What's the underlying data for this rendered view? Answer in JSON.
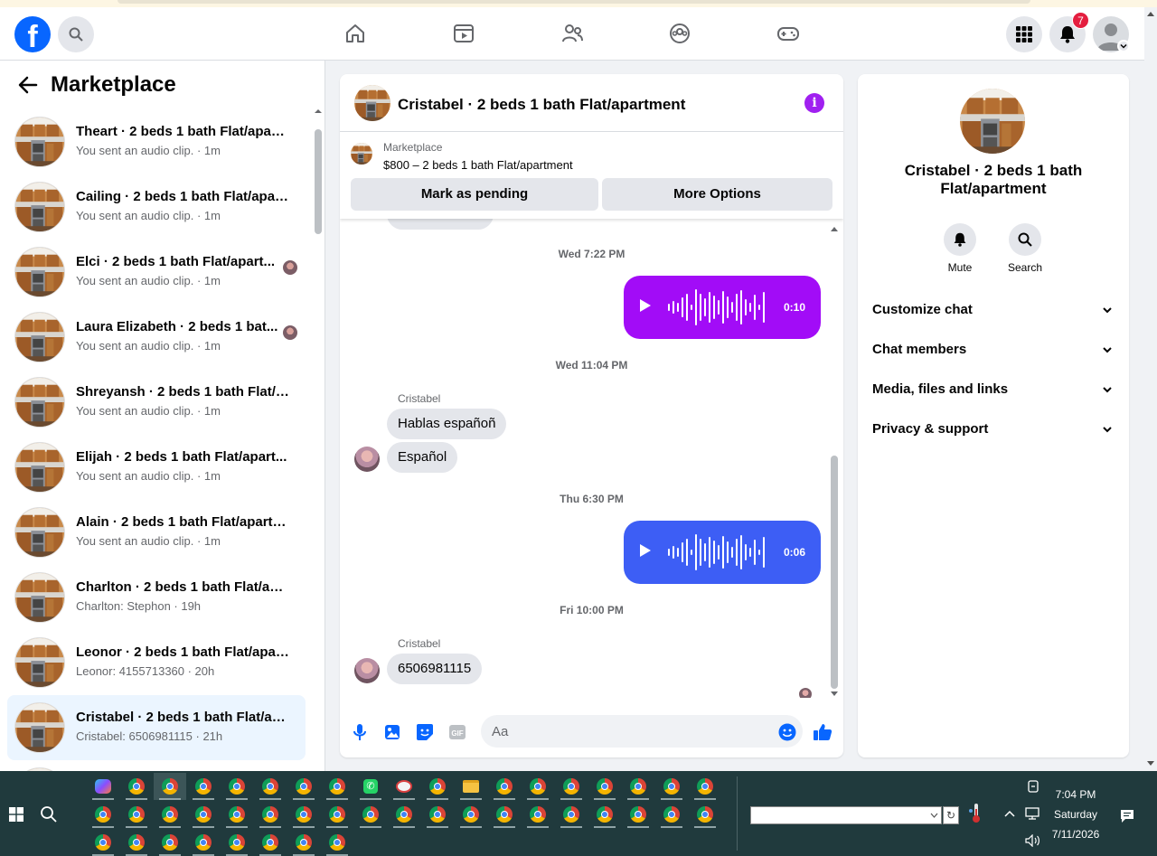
{
  "topnav": {
    "logo": "f",
    "notification_count": "7"
  },
  "sidebar": {
    "title": "Marketplace",
    "items": [
      {
        "name": "Theart · 2 beds 1 bath Flat/apart...",
        "sub": "You sent an audio clip. · 1m",
        "avatar": false
      },
      {
        "name": "Cailing · 2 beds 1 bath Flat/apart...",
        "sub": "You sent an audio clip. · 1m",
        "avatar": false
      },
      {
        "name": "Elci · 2 beds 1 bath Flat/apart...",
        "sub": "You sent an audio clip. · 1m",
        "avatar": true
      },
      {
        "name": "Laura Elizabeth · 2 beds 1 bat...",
        "sub": "You sent an audio clip. · 1m",
        "avatar": true
      },
      {
        "name": "Shreyansh · 2 beds 1 bath Flat/a...",
        "sub": "You sent an audio clip. · 1m",
        "avatar": false
      },
      {
        "name": "Elijah · 2 beds 1 bath Flat/apart...",
        "sub": "You sent an audio clip. · 1m",
        "avatar": false
      },
      {
        "name": "Alain · 2 beds 1 bath Flat/apartm...",
        "sub": "You sent an audio clip. · 1m",
        "avatar": false
      },
      {
        "name": "Charlton · 2 beds 1 bath Flat/apa...",
        "sub": "Charlton: Stephon · 19h",
        "avatar": false
      },
      {
        "name": "Leonor · 2 beds 1 bath Flat/apart...",
        "sub": "Leonor: 4155713360 · 20h",
        "avatar": false
      },
      {
        "name": "Cristabel · 2 beds 1 bath Flat/ap...",
        "sub": "Cristabel: 6506981115 · 21h",
        "avatar": false,
        "active": true
      }
    ]
  },
  "chat": {
    "title": "Cristabel · 2 beds 1 bath Flat/apartment",
    "marketplace_label": "Marketplace",
    "listing": "$800 – 2 beds 1 bath Flat/apartment",
    "btn_pending": "Mark as pending",
    "btn_more": "More Options",
    "messages": {
      "ts1": "Wed 7:22 PM",
      "audio1_duration": "0:10",
      "audio1_color": "#a20cf7",
      "ts2": "Wed 11:04 PM",
      "sender1": "Cristabel",
      "msg1": "Hablas españoñ",
      "msg2": "Español",
      "ts3": "Thu 6:30 PM",
      "audio2_duration": "0:06",
      "audio2_color": "#3d5ef5",
      "ts4": "Fri 10:00 PM",
      "sender2": "Cristabel",
      "msg3": "6506981115"
    },
    "composer_placeholder": "Aa"
  },
  "right_panel": {
    "title": "Cristabel · 2 beds 1 bath Flat/apartment",
    "mute": "Mute",
    "search": "Search",
    "rows": [
      "Customize chat",
      "Chat members",
      "Media, files and links",
      "Privacy & support"
    ]
  },
  "taskbar": {
    "time": "7:04 PM",
    "day": "Saturday",
    "date": "7/11/2026"
  },
  "colors": {
    "accent": "#0866ff",
    "purple": "#a020f0"
  }
}
